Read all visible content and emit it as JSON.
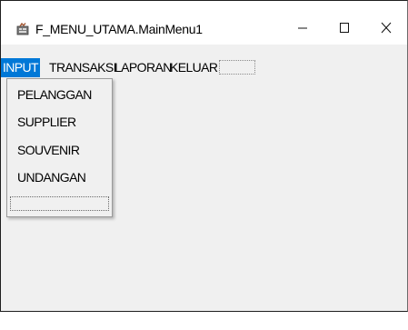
{
  "window": {
    "title": "F_MENU_UTAMA.MainMenu1",
    "icon": "form-app-icon",
    "controls": {
      "minimize_label": "–",
      "maximize_label": "☐",
      "close_label": "X"
    }
  },
  "menubar": {
    "items": [
      {
        "label": "INPUT",
        "active": true
      },
      {
        "label": "TRANSAKSI"
      },
      {
        "label": "LAPORAN"
      },
      {
        "label": "KELUAR"
      }
    ]
  },
  "dropdown": {
    "items": [
      {
        "label": "PELANGGAN"
      },
      {
        "label": "SUPPLIER"
      },
      {
        "label": "SOUVENIR"
      },
      {
        "label": "UNDANGAN"
      }
    ]
  },
  "colors": {
    "accent": "#0078d7",
    "window_bg": "#f0f0f0",
    "titlebar_bg": "#ffffff"
  }
}
